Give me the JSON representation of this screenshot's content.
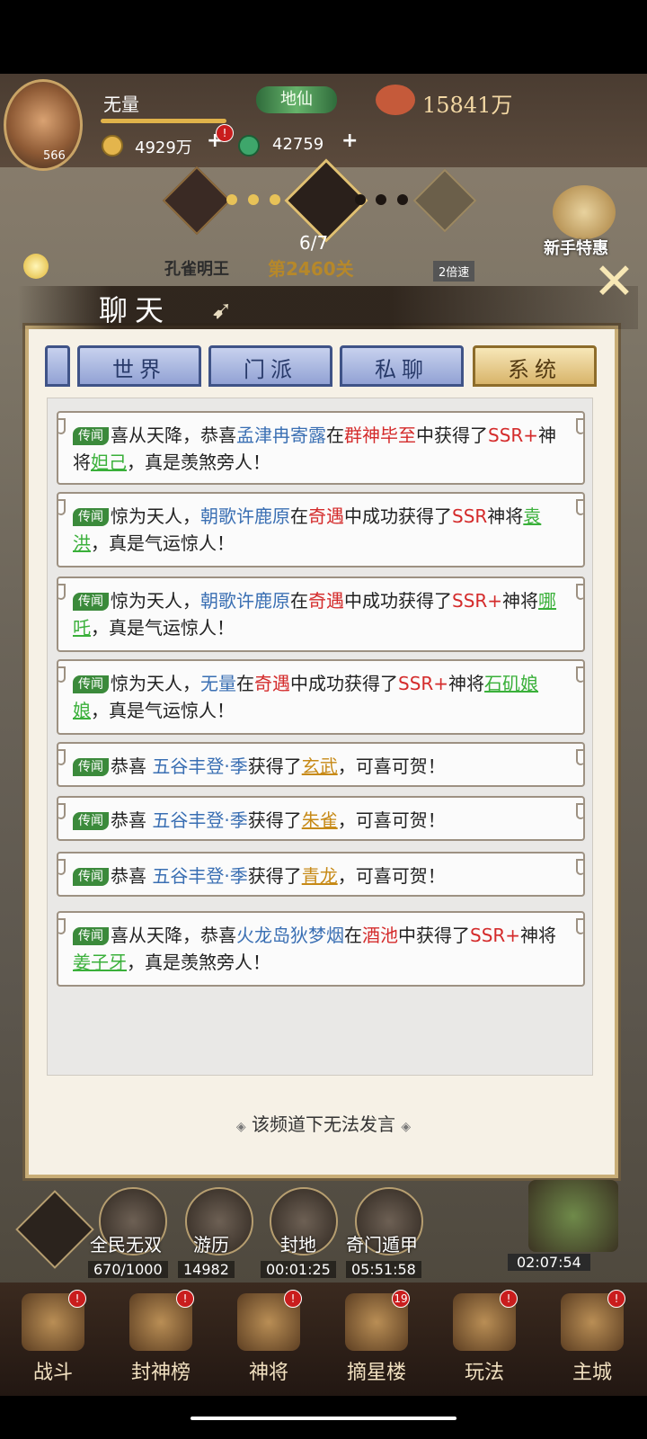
{
  "player": {
    "name": "无量",
    "level": "566",
    "rank": "地仙",
    "power": "15841万",
    "coins": "4929万",
    "jade": "42759"
  },
  "stage": {
    "progress": "6/7",
    "boss": "孔雀明王",
    "level": "第2460关",
    "speed": "2倍速"
  },
  "newbie_offer": "新手特惠",
  "chat": {
    "title": "聊天",
    "tabs": [
      "世界",
      "门派",
      "私聊",
      "系统"
    ],
    "active_tab": "系统",
    "messages": [
      {
        "tag": "传闻",
        "parts": [
          {
            "t": "喜从天降，恭喜",
            "c": ""
          },
          {
            "t": "孟津冉寄露",
            "c": "blue"
          },
          {
            "t": "在",
            "c": ""
          },
          {
            "t": "群神毕至",
            "c": "red"
          },
          {
            "t": "中获得了",
            "c": ""
          },
          {
            "t": "SSR+",
            "c": "red"
          },
          {
            "t": "神将",
            "c": ""
          },
          {
            "t": "妲己",
            "c": "green"
          },
          {
            "t": "，真是羡煞旁人！",
            "c": ""
          }
        ]
      },
      {
        "tag": "传闻",
        "parts": [
          {
            "t": "惊为天人，",
            "c": ""
          },
          {
            "t": "朝歌许鹿原",
            "c": "blue"
          },
          {
            "t": "在",
            "c": ""
          },
          {
            "t": "奇遇",
            "c": "red"
          },
          {
            "t": "中成功获得了",
            "c": ""
          },
          {
            "t": "SSR",
            "c": "red"
          },
          {
            "t": "神将",
            "c": ""
          },
          {
            "t": "袁洪",
            "c": "green"
          },
          {
            "t": "，真是气运惊人！",
            "c": ""
          }
        ]
      },
      {
        "tag": "传闻",
        "parts": [
          {
            "t": "惊为天人，",
            "c": ""
          },
          {
            "t": "朝歌许鹿原",
            "c": "blue"
          },
          {
            "t": "在",
            "c": ""
          },
          {
            "t": "奇遇",
            "c": "red"
          },
          {
            "t": "中成功获得了",
            "c": ""
          },
          {
            "t": "SSR+",
            "c": "red"
          },
          {
            "t": "神将",
            "c": ""
          },
          {
            "t": "哪吒",
            "c": "green"
          },
          {
            "t": "，真是气运惊人！",
            "c": ""
          }
        ]
      },
      {
        "tag": "传闻",
        "parts": [
          {
            "t": "惊为天人，",
            "c": ""
          },
          {
            "t": "无量",
            "c": "blue"
          },
          {
            "t": "在",
            "c": ""
          },
          {
            "t": "奇遇",
            "c": "red"
          },
          {
            "t": "中成功获得了",
            "c": ""
          },
          {
            "t": "SSR+",
            "c": "red"
          },
          {
            "t": "神将",
            "c": ""
          },
          {
            "t": "石矶娘娘",
            "c": "green"
          },
          {
            "t": "，真是气运惊人！",
            "c": ""
          }
        ]
      },
      {
        "tag": "传闻",
        "parts": [
          {
            "t": "恭喜 ",
            "c": ""
          },
          {
            "t": "五谷丰登·季",
            "c": "blue"
          },
          {
            "t": "获得了",
            "c": ""
          },
          {
            "t": "玄武",
            "c": "gold"
          },
          {
            "t": "，可喜可贺！",
            "c": ""
          }
        ]
      },
      {
        "tag": "传闻",
        "parts": [
          {
            "t": "恭喜 ",
            "c": ""
          },
          {
            "t": "五谷丰登·季",
            "c": "blue"
          },
          {
            "t": "获得了",
            "c": ""
          },
          {
            "t": "朱雀",
            "c": "gold"
          },
          {
            "t": "，可喜可贺！",
            "c": ""
          }
        ]
      },
      {
        "tag": "传闻",
        "parts": [
          {
            "t": "恭喜 ",
            "c": ""
          },
          {
            "t": "五谷丰登·季",
            "c": "blue"
          },
          {
            "t": "获得了",
            "c": ""
          },
          {
            "t": "青龙",
            "c": "gold"
          },
          {
            "t": "，可喜可贺！",
            "c": ""
          }
        ]
      },
      {
        "tag": "传闻",
        "parts": [
          {
            "t": "喜从天降，恭喜",
            "c": ""
          },
          {
            "t": "火龙岛狄梦烟",
            "c": "blue"
          },
          {
            "t": "在",
            "c": ""
          },
          {
            "t": "酒池",
            "c": "red"
          },
          {
            "t": "中获得了",
            "c": ""
          },
          {
            "t": "SSR+",
            "c": "red"
          },
          {
            "t": "神将",
            "c": ""
          },
          {
            "t": "姜子牙",
            "c": "green"
          },
          {
            "t": "，真是羡煞旁人！",
            "c": ""
          }
        ]
      }
    ],
    "no_speak": "该频道下无法发言"
  },
  "features": [
    {
      "label": "全民无双",
      "value": "670/1000"
    },
    {
      "label": "游历",
      "value": "14982"
    },
    {
      "label": "封地",
      "value": "00:01:25"
    },
    {
      "label": "奇门遁甲",
      "value": "05:51:58"
    }
  ],
  "chest_timer": "02:07:54",
  "nav": [
    {
      "label": "战斗",
      "badge": "!"
    },
    {
      "label": "封神榜",
      "badge": "!"
    },
    {
      "label": "神将",
      "badge": "!"
    },
    {
      "label": "摘星楼",
      "badge": "19"
    },
    {
      "label": "玩法",
      "badge": "!"
    },
    {
      "label": "主城",
      "badge": "!"
    }
  ]
}
